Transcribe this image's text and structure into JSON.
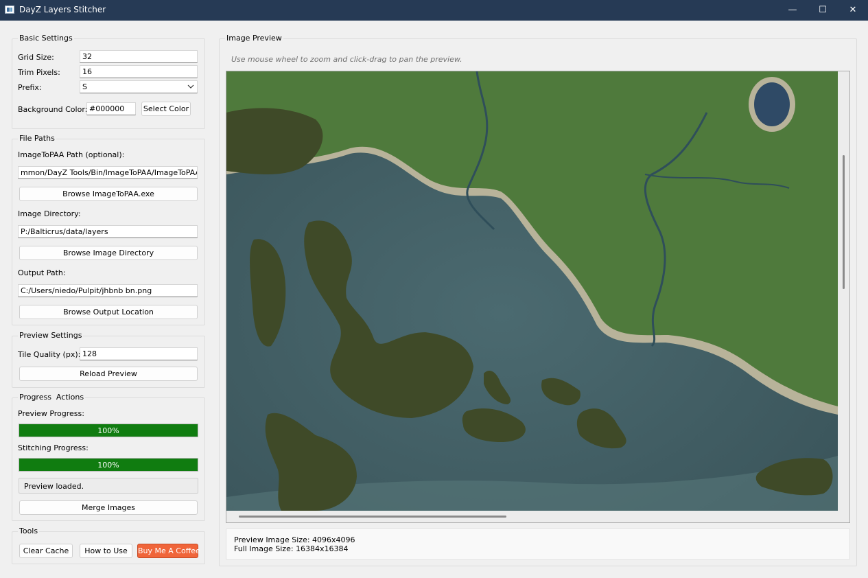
{
  "window": {
    "title": "DayZ Layers Stitcher",
    "controls": {
      "minimize": "—",
      "maximize": "☐",
      "close": "✕"
    }
  },
  "basic_settings": {
    "title": "Basic Settings",
    "grid_size_label": "Grid Size:",
    "grid_size_value": "32",
    "trim_pixels_label": "Trim Pixels:",
    "trim_pixels_value": "16",
    "prefix_label": "Prefix:",
    "prefix_value": "S",
    "bg_color_label": "Background Color:",
    "bg_color_value": "#000000",
    "select_color_button": "Select Color"
  },
  "file_paths": {
    "title": "File Paths",
    "imagetopaa_label": "ImageToPAA Path (optional):",
    "imagetopaa_value": "mmon/DayZ Tools/Bin/ImageToPAA/ImageToPAA.exe",
    "browse_imagetopaa_button": "Browse ImageToPAA.exe",
    "image_dir_label": "Image Directory:",
    "image_dir_value": "P:/Balticrus/data/layers",
    "browse_image_dir_button": "Browse Image Directory",
    "output_path_label": "Output Path:",
    "output_path_value": "C:/Users/niedo/Pulpit/jhbnb bn.png",
    "browse_output_button": "Browse Output Location"
  },
  "preview_settings": {
    "title": "Preview Settings",
    "tile_quality_label": "Tile Quality (px):",
    "tile_quality_value": "128",
    "reload_preview_button": "Reload Preview"
  },
  "progress_actions": {
    "title": "Progress  Actions",
    "preview_progress_label": "Preview Progress:",
    "preview_progress_value": 1.0,
    "preview_progress_text": "100%",
    "stitching_progress_label": "Stitching Progress:",
    "stitching_progress_value": 1.0,
    "stitching_progress_text": "100%",
    "status_text": "Preview loaded.",
    "merge_images_button": "Merge Images",
    "progress_color": "#107c10"
  },
  "tools": {
    "title": "Tools",
    "clear_cache_button": "Clear Cache",
    "how_to_use_button": "How to Use",
    "buy_coffee_button": "Buy Me A Coffee",
    "coffee_color": "#f0653a"
  },
  "image_preview": {
    "title": "Image Preview",
    "hint": "Use mouse wheel to zoom and click-drag to pan the preview.",
    "preview_size_text": "Preview Image Size: 4096x4096",
    "full_size_text": "Full Image Size: 16384x16384",
    "colors": {
      "sea": "#3e5a60",
      "shallow": "#61807f",
      "land": "#4f7a3c",
      "forest": "#3f4a28",
      "beach": "#b8b39a",
      "river": "#2f4e5a"
    }
  }
}
